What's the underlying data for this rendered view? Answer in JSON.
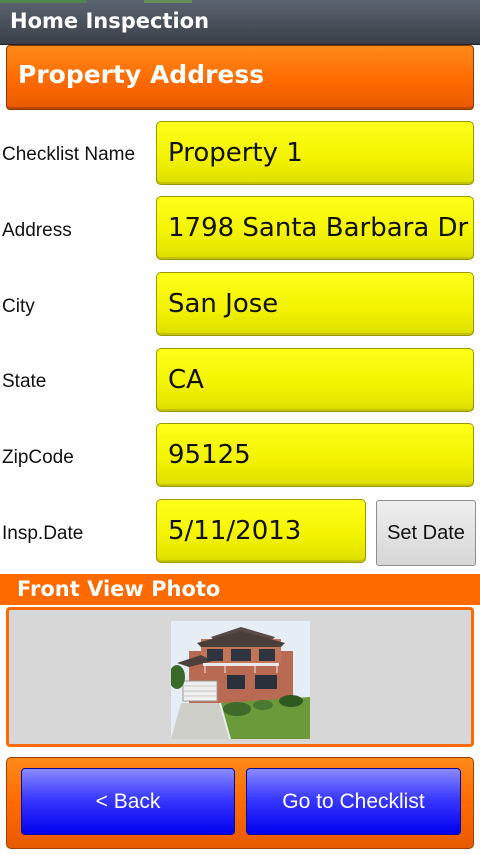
{
  "app": {
    "title": "Home Inspection"
  },
  "section": {
    "title": "Property Address"
  },
  "form": {
    "checklist_name": {
      "label": "Checklist Name",
      "value": "Property 1"
    },
    "address": {
      "label": "Address",
      "value": "1798 Santa Barbara Dr"
    },
    "city": {
      "label": "City",
      "value": "San Jose"
    },
    "state": {
      "label": "State",
      "value": "CA"
    },
    "zipcode": {
      "label": "ZipCode",
      "value": "95125"
    },
    "insp_date": {
      "label": "Insp.Date",
      "value": "5/11/2013"
    },
    "set_date_label": "Set Date"
  },
  "photo": {
    "title": "Front View Photo"
  },
  "actions": {
    "back_label": "< Back",
    "checklist_label": "Go to Checklist"
  },
  "colors": {
    "accent_orange": "#ff6a00",
    "field_yellow": "#f2f200",
    "button_blue": "#0000ee"
  }
}
